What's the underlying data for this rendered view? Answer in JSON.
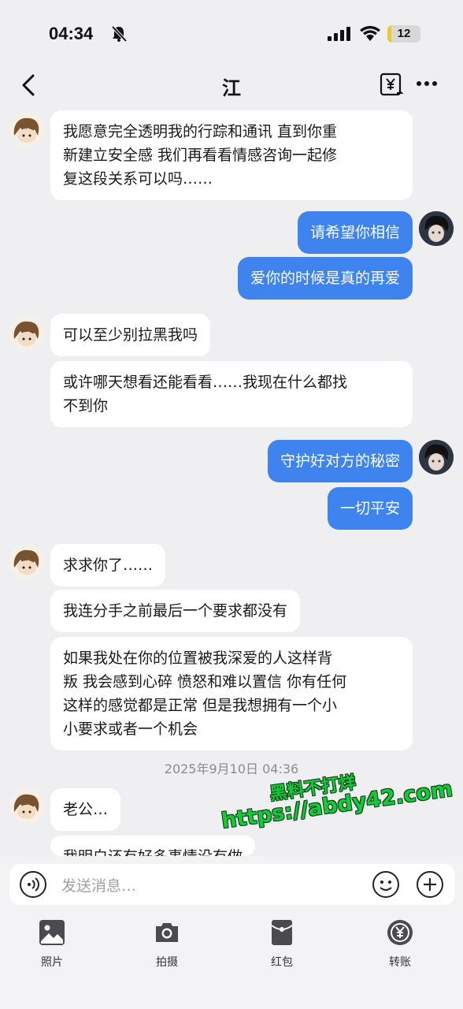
{
  "status": {
    "time": "04:34",
    "battery": "12",
    "battery_level": 0.12
  },
  "header": {
    "title": "江",
    "icons": [
      "back-icon",
      "transfer-icon",
      "more-icon"
    ]
  },
  "messages": [
    {
      "side": "left",
      "text": "我愿意完全透明我的行踪和通讯 直到你重\n新建立安全感 我们再看看情感咨询一起修\n复这段关系可以吗……"
    },
    {
      "side": "right",
      "text": "请希望你相信"
    },
    {
      "side": "right",
      "text": "爱你的时候是真的再爱"
    },
    {
      "side": "left",
      "text": "可以至少别拉黑我吗"
    },
    {
      "side": "left",
      "text": "或许哪天想看还能看看……我现在什么都找\n不到你"
    },
    {
      "side": "right",
      "text": "守护好对方的秘密"
    },
    {
      "side": "right",
      "text": "一切平安"
    },
    {
      "side": "left",
      "text": "求求你了……"
    },
    {
      "side": "left",
      "text": "我连分手之前最后一个要求都没有"
    },
    {
      "side": "left",
      "text": "如果我处在你的位置被我深爱的人这样背\n叛 我会感到心碎 愤怒和难以置信 你有任何\n这样的感觉都是正常 但是我想拥有一个小\n小要求或者一个机会"
    },
    {
      "side": "left",
      "text": "老公…"
    },
    {
      "side": "left",
      "text": "我明白还有好多事情没有做"
    }
  ],
  "timestamp": "2025年9月10日 04:36",
  "watermark": {
    "line1": "黑料不打烊",
    "line2": "https://abdy42.com"
  },
  "input": {
    "placeholder": "发送消息…"
  },
  "toolbar": [
    {
      "label": "照片",
      "icon": "photo-icon"
    },
    {
      "label": "拍摄",
      "icon": "camera-icon"
    },
    {
      "label": "红包",
      "icon": "red-packet-icon"
    },
    {
      "label": "转账",
      "icon": "transfer-money-icon"
    }
  ],
  "colors": {
    "background": "#efeff2",
    "bubble_self": "#3f83ee",
    "bubble_other": "#ffffff",
    "watermark": "#16c93a"
  }
}
